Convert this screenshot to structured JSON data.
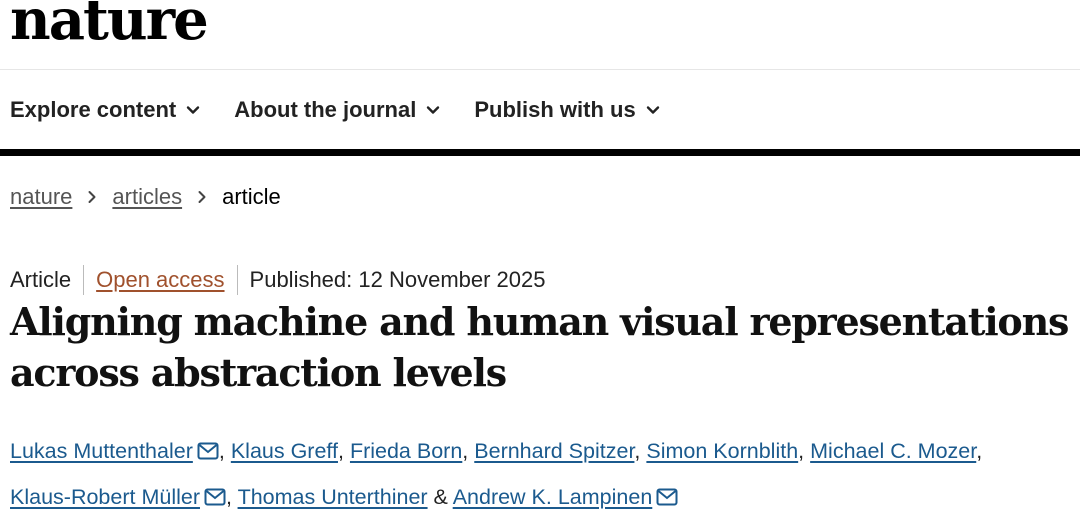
{
  "header": {
    "logo_text": "nature"
  },
  "nav": {
    "items": [
      {
        "label": "Explore content"
      },
      {
        "label": "About the journal"
      },
      {
        "label": "Publish with us"
      }
    ]
  },
  "breadcrumb": {
    "items": [
      "nature",
      "articles",
      "article"
    ]
  },
  "article": {
    "type": "Article",
    "access": "Open access",
    "published": "Published: 12 November 2025",
    "title_line1": "Aligning machine and human visual representations",
    "title_line2": "across abstraction levels",
    "authors": [
      "Lukas Muttenthaler",
      "Klaus Greff",
      "Frieda Born",
      "Bernhard Spitzer",
      "Simon Kornblith",
      "Michael C. Mozer",
      "Klaus-Robert Müller",
      "Thomas Unterthiner",
      "Andrew K. Lampinen"
    ],
    "author_separator": ",",
    "author_last_joiner": "&"
  },
  "colors": {
    "author_link": "#1b5a8e",
    "open_access": "#a0512d",
    "nav_rule": "#000000"
  },
  "icons": [
    "chevron-down-icon",
    "chevron-right-icon",
    "mail-icon"
  ]
}
